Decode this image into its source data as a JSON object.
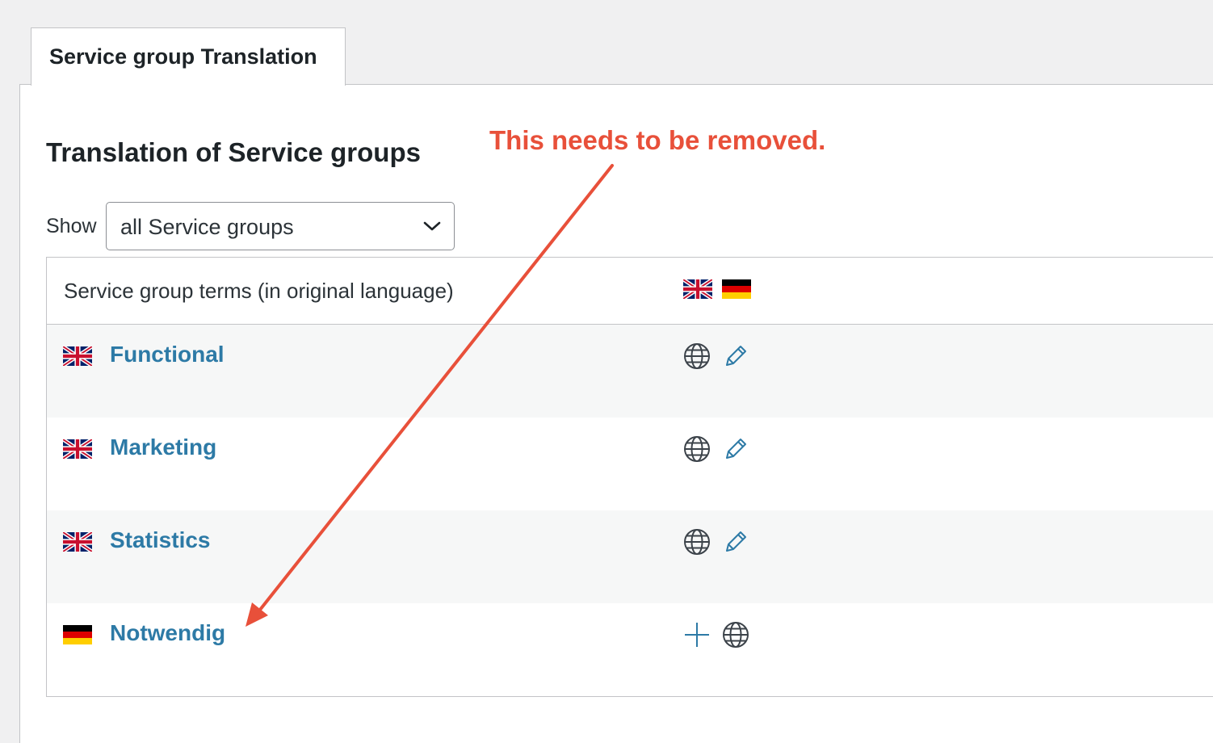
{
  "tab": {
    "label": "Service group Translation"
  },
  "page": {
    "title": "Translation of Service groups"
  },
  "annotation": {
    "text": "This needs to be removed.",
    "color": "#e8503a"
  },
  "filter": {
    "label": "Show",
    "selected": "all Service groups"
  },
  "table": {
    "header": {
      "title": "Service group terms (in original language)",
      "languages": [
        "en-flag-icon",
        "de-flag-icon"
      ]
    },
    "rows": [
      {
        "flag": "en-flag-icon",
        "term": "Functional",
        "actions": [
          "globe-icon",
          "pencil-icon"
        ]
      },
      {
        "flag": "en-flag-icon",
        "term": "Marketing",
        "actions": [
          "globe-icon",
          "pencil-icon"
        ]
      },
      {
        "flag": "en-flag-icon",
        "term": "Statistics",
        "actions": [
          "globe-icon",
          "pencil-icon"
        ]
      },
      {
        "flag": "de-flag-icon",
        "term": "Notwendig",
        "actions": [
          "plus-icon",
          "globe-icon"
        ]
      }
    ]
  },
  "colors": {
    "link": "#2d7aa6",
    "accent_red": "#e8503a",
    "row_alt": "#f6f7f7"
  }
}
